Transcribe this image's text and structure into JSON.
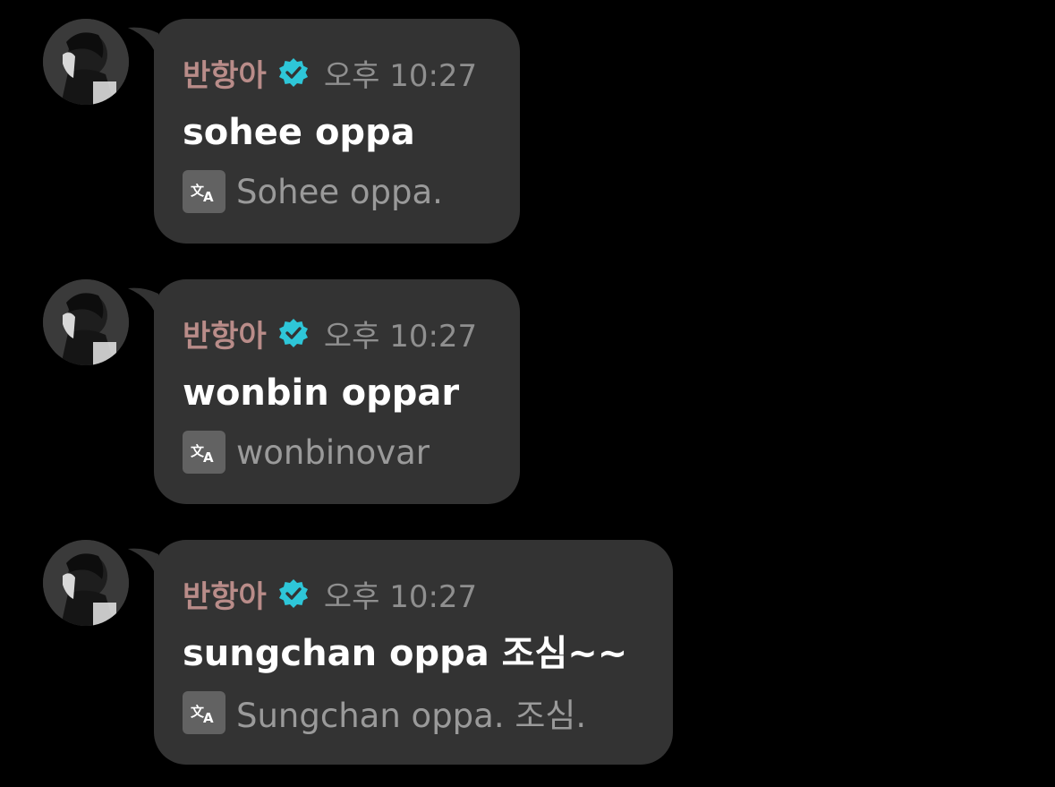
{
  "colors": {
    "background": "#000000",
    "bubble": "#333333",
    "sender_name": "#b98c89",
    "verified_badge": "#2ec6d8",
    "timestamp": "#8f8f8f",
    "message_text": "#ffffff",
    "translation_text": "#9a9a9a",
    "translate_icon_bg": "#626262"
  },
  "icons": {
    "verified": "verified-badge-icon",
    "translate": "translate-icon",
    "avatar": "profile-avatar"
  },
  "messages": [
    {
      "sender": "반항아",
      "time": "오후 10:27",
      "text": "sohee oppa",
      "translation": "Sohee oppa."
    },
    {
      "sender": "반항아",
      "time": "오후 10:27",
      "text": "wonbin oppar",
      "translation": "wonbinovar"
    },
    {
      "sender": "반항아",
      "time": "오후 10:27",
      "text": "sungchan oppa 조심~~",
      "translation": "Sungchan oppa. 조심."
    }
  ]
}
